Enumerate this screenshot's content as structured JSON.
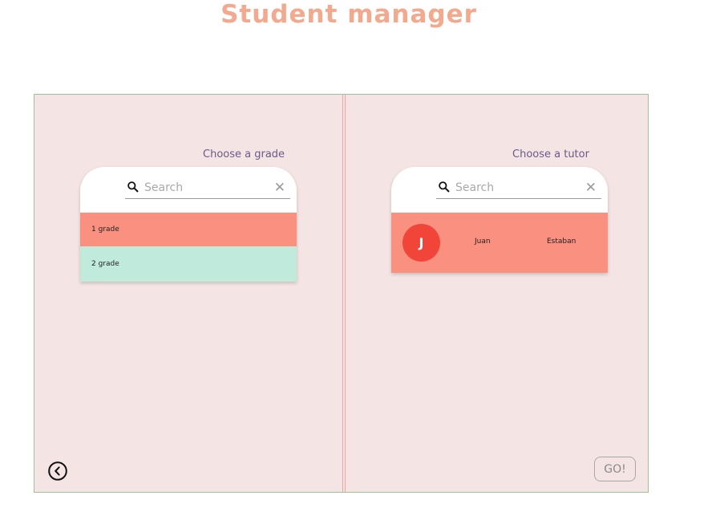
{
  "app": {
    "title": "Student manager"
  },
  "grade_panel": {
    "label": "Choose a grade",
    "search": {
      "placeholder": "Search",
      "value": "",
      "clear_glyph": "✕"
    },
    "items": [
      {
        "label": "1 grade",
        "color": "#fa9080"
      },
      {
        "label": "2 grade",
        "color": "#bfeadc"
      }
    ]
  },
  "tutor_panel": {
    "label": "Choose a tutor",
    "search": {
      "placeholder": "Search",
      "value": "",
      "clear_glyph": "✕"
    },
    "items": [
      {
        "initial": "J",
        "first_name": "Juan",
        "last_name": "Estaban",
        "color": "#fa9080",
        "avatar_color": "#f1453a"
      }
    ]
  },
  "footer": {
    "back_icon": "chevron-left-circle-icon",
    "go_label": "GO!"
  },
  "colors": {
    "accent": "#f2a98e",
    "board_bg": "#f5e4e4",
    "border": "#9cc29c",
    "divider": "#f0a59c"
  }
}
